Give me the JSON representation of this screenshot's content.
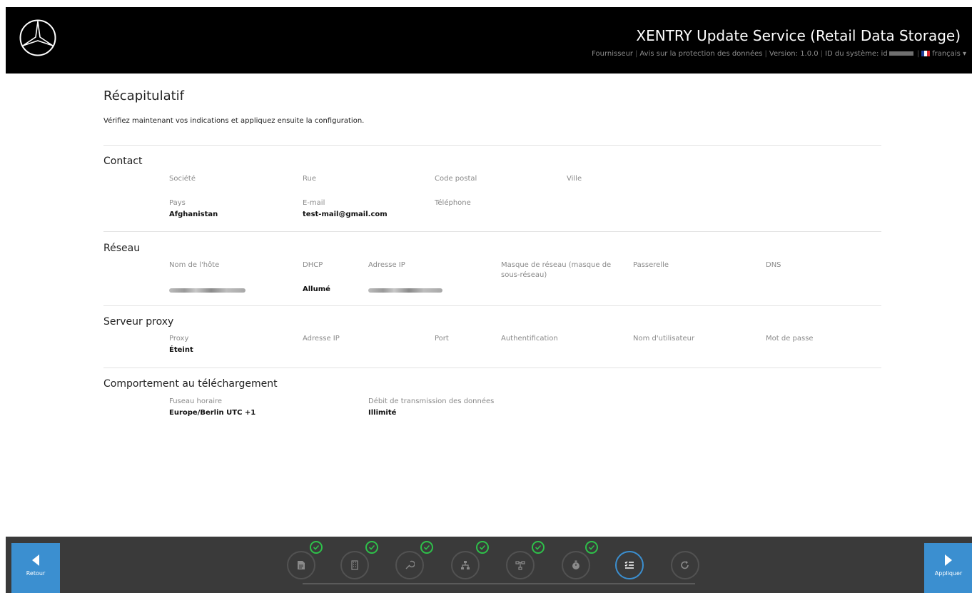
{
  "header": {
    "title": "XENTRY Update Service (Retail Data Storage)",
    "meta": {
      "provider": "Fournisseur",
      "privacy": "Avis sur la protection des données",
      "version": "Version: 1.0.0",
      "system_id_label": "ID du système: id",
      "language": "français"
    }
  },
  "page": {
    "title": "Récapitulatif",
    "intro": "Vérifiez maintenant vos indications et appliquez ensuite la configuration."
  },
  "contact": {
    "title": "Contact",
    "company_label": "Société",
    "street_label": "Rue",
    "postal_label": "Code postal",
    "city_label": "Ville",
    "country_label": "Pays",
    "country_value": "Afghanistan",
    "email_label": "E-mail",
    "email_value": "test-mail@gmail.com",
    "phone_label": "Téléphone"
  },
  "network": {
    "title": "Réseau",
    "hostname_label": "Nom de l'hôte",
    "dhcp_label": "DHCP",
    "dhcp_value": "Allumé",
    "ip_label": "Adresse IP",
    "mask_label_1": "Masque de réseau (masque de",
    "mask_label_2": "sous-réseau)",
    "gateway_label": "Passerelle",
    "dns_label": "DNS"
  },
  "proxy": {
    "title": "Serveur proxy",
    "proxy_label": "Proxy",
    "proxy_value": "Éteint",
    "ip_label": "Adresse IP",
    "port_label": "Port",
    "auth_label": "Authentification",
    "user_label": "Nom d'utilisateur",
    "password_label": "Mot de passe"
  },
  "download": {
    "title": "Comportement au téléchargement",
    "timezone_label": "Fuseau horaire",
    "timezone_value": "Europe/Berlin UTC +1",
    "rate_label": "Débit de transmission des données",
    "rate_value": "Illimité"
  },
  "footer": {
    "back_label": "Retour",
    "apply_label": "Appliquer",
    "steps": [
      {
        "icon": "document-icon",
        "completed": true
      },
      {
        "icon": "building-icon",
        "completed": true
      },
      {
        "icon": "wrench-icon",
        "completed": true
      },
      {
        "icon": "network-icon",
        "completed": true
      },
      {
        "icon": "proxy-icon",
        "completed": true
      },
      {
        "icon": "stopwatch-icon",
        "completed": true
      },
      {
        "icon": "checklist-icon",
        "completed": false,
        "active": true
      },
      {
        "icon": "restart-icon",
        "completed": false
      }
    ]
  },
  "colors": {
    "header_bg": "#000000",
    "accent": "#3b8fd0",
    "footer_bg": "#3a3a3a",
    "check": "#2ec04a"
  }
}
